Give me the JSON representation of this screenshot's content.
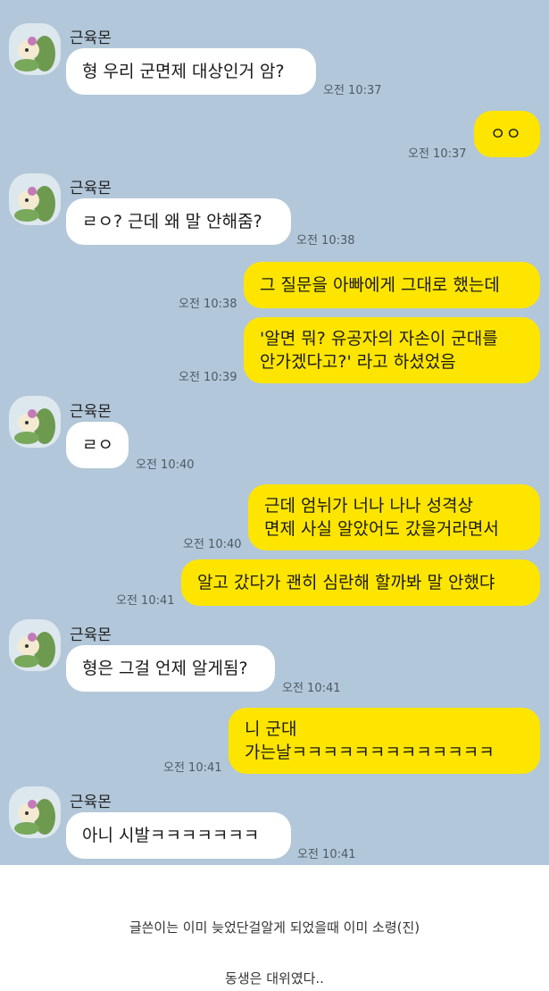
{
  "chat": {
    "sender_name": "근육몬",
    "avatar_icon": "character-avatar-icon",
    "colors": {
      "background": "#b2c7d9",
      "my_bubble": "#fee500",
      "their_bubble": "#ffffff"
    },
    "messages": [
      {
        "text": "형 우리 군면제 대상인거 암?",
        "time": "오전 10:37"
      },
      {
        "text": "ㅇㅇ",
        "time": "오전 10:37"
      },
      {
        "text": "ㄹㅇ? 근데 왜 말 안해줌?",
        "time": "오전 10:38"
      },
      {
        "text": "그 질문을 아빠에게 그대로 했는데",
        "time": "오전 10:38"
      },
      {
        "line1": "'알면 뭐? 유공자의 자손이 군대를",
        "line2": "안가겠다고?' 라고 하셨었음",
        "time": "오전 10:39"
      },
      {
        "text": "ㄹㅇ",
        "time": "오전 10:40"
      },
      {
        "line1": "근데 엄뉘가 너나 나나 성격상",
        "line2": "면제 사실 알았어도 갔을거라면서",
        "time": "오전 10:40"
      },
      {
        "text": "알고 갔다가 괜히 심란해 할까봐 말 안했댜",
        "time": "오전 10:41"
      },
      {
        "text": "형은 그걸 언제 알게됨?",
        "time": "오전 10:41"
      },
      {
        "line1": "니 군대",
        "line2": "가는날ㅋㅋㅋㅋㅋㅋㅋㅋㅋㅋㅋㅋㅋ",
        "time": "오전 10:41"
      },
      {
        "text": "아니 시발ㅋㅋㅋㅋㅋㅋㅋ",
        "time": "오전 10:41"
      }
    ]
  },
  "captions": {
    "line1": "글쓴이는 이미 늦었단걸알게 되었을때 이미 소령(진)",
    "line2": "동생은 대위였다.."
  }
}
